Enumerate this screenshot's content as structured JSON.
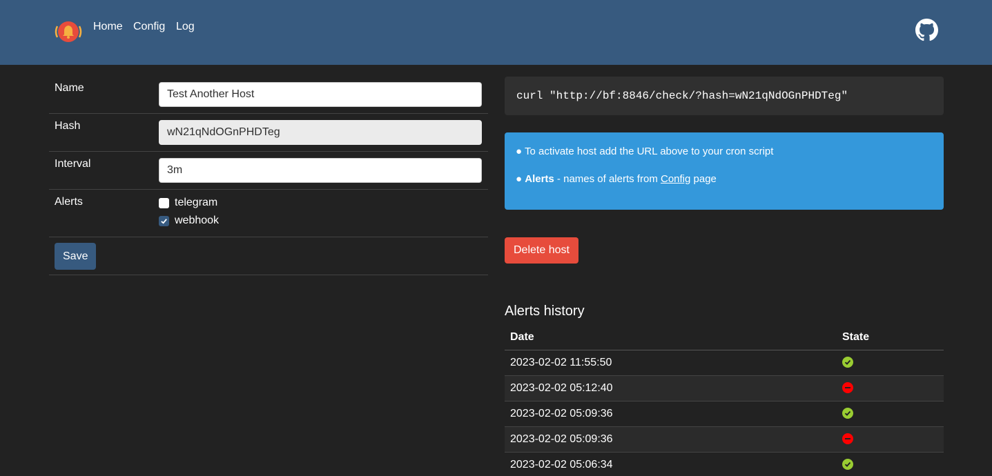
{
  "nav": {
    "brand_icon": "bell-logo-icon",
    "links": [
      "Home",
      "Config",
      "Log"
    ],
    "github_icon": "github-icon"
  },
  "form": {
    "name_label": "Name",
    "name_value": "Test Another Host",
    "hash_label": "Hash",
    "hash_value": "wN21qNdOGnPHDTeg",
    "interval_label": "Interval",
    "interval_value": "3m",
    "alerts_label": "Alerts",
    "alerts": [
      {
        "label": "telegram",
        "checked": false
      },
      {
        "label": "webhook",
        "checked": true
      }
    ],
    "save_label": "Save"
  },
  "curl_command": "curl \"http://bf:8846/check/?hash=wN21qNdOGnPHDTeg\"",
  "info": {
    "bullet": "●",
    "line1": "To activate host add the URL above to your cron script",
    "line2_bold": "Alerts",
    "line2_mid": " - names of alerts from ",
    "line2_link": "Config",
    "line2_end": " page"
  },
  "delete_label": "Delete host",
  "history": {
    "title": "Alerts history",
    "col_date": "Date",
    "col_state": "State",
    "rows": [
      {
        "date": "2023-02-02 11:55:50",
        "state": "ok"
      },
      {
        "date": "2023-02-02 05:12:40",
        "state": "fail"
      },
      {
        "date": "2023-02-02 05:09:36",
        "state": "ok"
      },
      {
        "date": "2023-02-02 05:09:36",
        "state": "fail"
      },
      {
        "date": "2023-02-02 05:06:34",
        "state": "ok"
      }
    ]
  },
  "colors": {
    "navbar": "#375a7f",
    "background": "#222222",
    "info": "#3498db",
    "danger": "#e74c3c",
    "ok": "#9acd32",
    "fail": "#ff0000"
  }
}
